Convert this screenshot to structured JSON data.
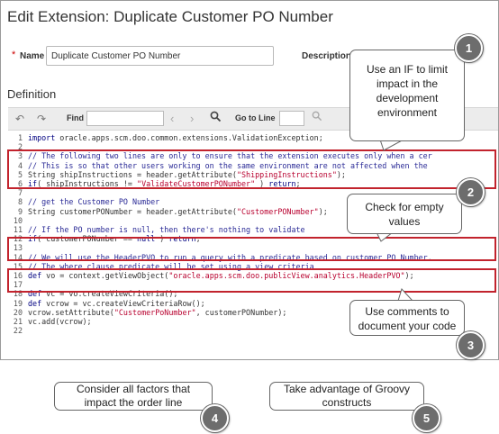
{
  "page_title": "Edit Extension: Duplicate Customer PO Number",
  "name_field": {
    "required_mark": "*",
    "label": "Name",
    "value": "Duplicate Customer PO Number"
  },
  "description_label": "Description",
  "definition_title": "Definition",
  "toolbar": {
    "undo_icon": "undo-icon",
    "redo_icon": "redo-icon",
    "find_label": "Find",
    "prev_icon": "chevron-left-icon",
    "next_icon": "chevron-right-icon",
    "search_icon": "search-icon",
    "goto_label": "Go to Line"
  },
  "code_lines": [
    {
      "n": "1",
      "segs": [
        {
          "c": "kw",
          "t": "import"
        },
        {
          "c": "plain",
          "t": " oracle.apps.scm.doo.common.extensions.ValidationException;"
        }
      ]
    },
    {
      "n": "2",
      "segs": []
    },
    {
      "n": "3",
      "segs": [
        {
          "c": "cmt",
          "t": "// The following two lines are only to ensure that the extension executes only when a cer"
        }
      ]
    },
    {
      "n": "4",
      "segs": [
        {
          "c": "cmt",
          "t": "// This is so that other users working on the same environment are not affected when the"
        }
      ]
    },
    {
      "n": "5",
      "segs": [
        {
          "c": "plain",
          "t": "String shipInstructions = header.getAttribute("
        },
        {
          "c": "str",
          "t": "\"ShippingInstructions\""
        },
        {
          "c": "plain",
          "t": ");"
        }
      ]
    },
    {
      "n": "6",
      "segs": [
        {
          "c": "kw",
          "t": "if"
        },
        {
          "c": "plain",
          "t": "( shipInstructions != "
        },
        {
          "c": "str",
          "t": "\"ValidateCustomerPONumber\""
        },
        {
          "c": "plain",
          "t": " ) "
        },
        {
          "c": "kw",
          "t": "return"
        },
        {
          "c": "plain",
          "t": ";"
        }
      ]
    },
    {
      "n": "7",
      "segs": []
    },
    {
      "n": "8",
      "segs": [
        {
          "c": "cmt",
          "t": "// get the Customer PO Number"
        }
      ]
    },
    {
      "n": "9",
      "segs": [
        {
          "c": "plain",
          "t": "String customerPONumber = header.getAttribute("
        },
        {
          "c": "str",
          "t": "\"CustomerPONumber\""
        },
        {
          "c": "plain",
          "t": ");"
        }
      ]
    },
    {
      "n": "10",
      "segs": []
    },
    {
      "n": "11",
      "segs": [
        {
          "c": "cmt",
          "t": "// If the PO number is null, then there's nothing to validate"
        }
      ]
    },
    {
      "n": "12",
      "segs": [
        {
          "c": "kw",
          "t": "if"
        },
        {
          "c": "plain",
          "t": "( customerPONumber == "
        },
        {
          "c": "kw",
          "t": "null"
        },
        {
          "c": "plain",
          "t": " ) "
        },
        {
          "c": "kw",
          "t": "return"
        },
        {
          "c": "plain",
          "t": ";"
        }
      ]
    },
    {
      "n": "13",
      "segs": []
    },
    {
      "n": "14",
      "segs": [
        {
          "c": "cmt",
          "t": "// We will use the HeaderPVO to run a query with a predicate based on customer PO Number."
        }
      ]
    },
    {
      "n": "15",
      "segs": [
        {
          "c": "cmt",
          "t": "// The where clause predicate will be set using a view criteria"
        }
      ]
    },
    {
      "n": "16",
      "segs": [
        {
          "c": "kw",
          "t": "def"
        },
        {
          "c": "plain",
          "t": " vo = context.getViewObject("
        },
        {
          "c": "str",
          "t": "\"oracle.apps.scm.doo.publicView.analytics.HeaderPVO\""
        },
        {
          "c": "plain",
          "t": ");"
        }
      ]
    },
    {
      "n": "17",
      "segs": []
    },
    {
      "n": "18",
      "segs": [
        {
          "c": "kw",
          "t": "def"
        },
        {
          "c": "plain",
          "t": " vc = vo.createViewCriteria();"
        }
      ]
    },
    {
      "n": "19",
      "segs": [
        {
          "c": "kw",
          "t": "def"
        },
        {
          "c": "plain",
          "t": " vcrow = vc.createViewCriteriaRow();"
        }
      ]
    },
    {
      "n": "20",
      "segs": [
        {
          "c": "plain",
          "t": "vcrow.setAttribute("
        },
        {
          "c": "str",
          "t": "\"CustomerPoNumber\""
        },
        {
          "c": "plain",
          "t": ", customerPONumber);"
        }
      ]
    },
    {
      "n": "21",
      "segs": [
        {
          "c": "plain",
          "t": "vc.add(vcrow);"
        }
      ]
    },
    {
      "n": "22",
      "segs": []
    }
  ],
  "callouts": [
    {
      "number": "1",
      "text": "Use an IF to limit impact in the development environment"
    },
    {
      "number": "2",
      "text": "Check for empty values"
    },
    {
      "number": "3",
      "text": "Use comments to document your code"
    },
    {
      "number": "4",
      "text": "Consider all factors that impact the order line"
    },
    {
      "number": "5",
      "text": "Take advantage of Groovy constructs"
    }
  ],
  "colors": {
    "highlight": "#c2232d",
    "badge": "#6d6d6d",
    "comment": "#2a2a96",
    "string": "#b8002e",
    "keyword": "#000080"
  }
}
